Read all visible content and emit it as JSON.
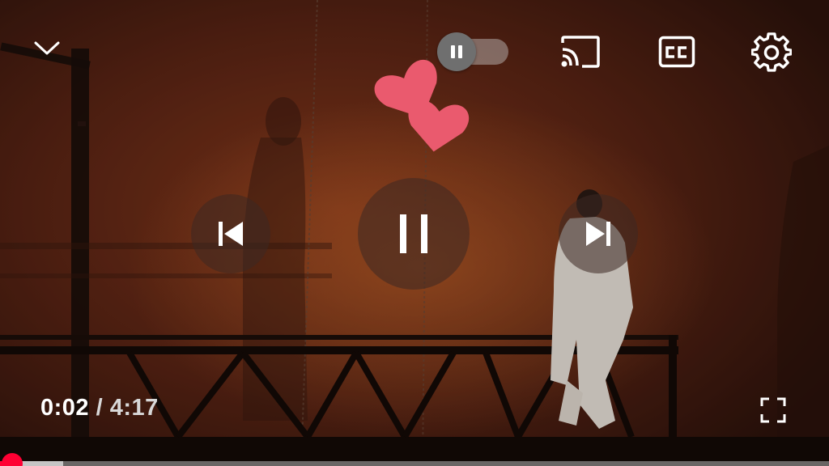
{
  "player": {
    "time": {
      "current": "0:02",
      "separator": "/",
      "duration": "4:17"
    },
    "progress": {
      "played_fraction": 0.008,
      "buffered_fraction": 0.076,
      "played_color": "#ff0033"
    },
    "autoplay": {
      "state": "paused",
      "icon": "pause-icon"
    },
    "controls": {
      "top": [
        "chevron-down-icon",
        "cast-icon",
        "cc-icon",
        "gear-icon"
      ],
      "center": [
        "skip-previous-icon",
        "pause-icon",
        "skip-next-icon"
      ],
      "bottom": [
        "fullscreen-icon"
      ]
    },
    "overlay": {
      "reaction": "heart-icon",
      "heart_color": "#ea5a6e"
    }
  }
}
